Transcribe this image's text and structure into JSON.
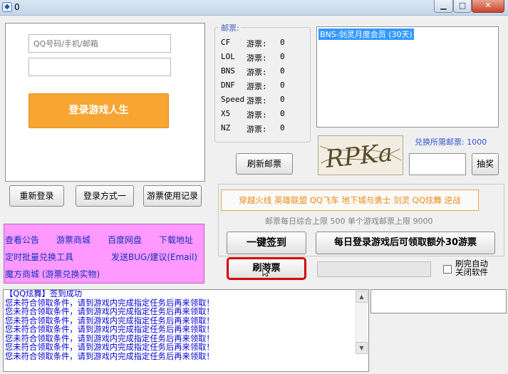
{
  "window": {
    "title": "0",
    "icon": "app-icon",
    "controls": [
      "minimize",
      "maximize",
      "close"
    ]
  },
  "login": {
    "account_placeholder": "QQ号码/手机/邮箱",
    "password_placeholder": "",
    "login_button": "登录游戏人生"
  },
  "actions": {
    "relogin": "重新登录",
    "login_mode": "登录方式一",
    "ticket_log": "游票使用记录"
  },
  "links": {
    "announcement": "查看公告",
    "ticket_store": "游票商城",
    "baidu_pan": "百度网盘",
    "download": "下载地址",
    "batch_exchange": "定时批量兑换工具",
    "send_bug": "发送BUG/建议(Email)",
    "magic_store": "魔方商城 (游票兑换实物)"
  },
  "tickets": {
    "title": "邮票:",
    "column_label": "游票:",
    "rows": [
      {
        "game": "CF",
        "value": "0"
      },
      {
        "game": "LOL",
        "value": "0"
      },
      {
        "game": "BNS",
        "value": "0"
      },
      {
        "game": "DNF",
        "value": "0"
      },
      {
        "game": "Speed",
        "value": "0"
      },
      {
        "game": "X5",
        "value": "0"
      },
      {
        "game": "NZ",
        "value": "0"
      }
    ],
    "refresh_button": "刷新邮票"
  },
  "items": {
    "selected": "BNS-剑灵月度会员 (30天)"
  },
  "exchange": {
    "captcha_text": "RPKa",
    "cost_label": "兑换所需邮票:",
    "cost_value": "1000",
    "lottery_button": "抽奖"
  },
  "games": {
    "tags": "穿越火线 英雄联盟 QQ飞车 地下城与勇士 剑灵 QQ炫舞 逆战",
    "limit_label": "邮票每日综合上限",
    "daily_limit": "500",
    "single_label": "单个游戏邮票上限",
    "single_limit": "9000"
  },
  "controls": {
    "sign_in": "一键签到",
    "daily_extra": "每日登录游戏后可领取额外30游票",
    "refresh_coupon": "刷游票",
    "auto_close_line1": "刷完自动",
    "auto_close_line2": "关闭软件",
    "auto_close_checked": false
  },
  "log": [
    "【QQ炫舞】签到成功",
    "您未符合领取条件，请到游戏内完成指定任务后再来领取！",
    "您未符合领取条件，请到游戏内完成指定任务后再来领取！",
    "您未符合领取条件，请到游戏内完成指定任务后再来领取！",
    "您未符合领取条件，请到游戏内完成指定任务后再来领取！",
    "您未符合领取条件，请到游戏内完成指定任务后再来领取！",
    "您未符合领取条件，请到游戏内完成指定任务后再来领取！",
    "您未符合领取条件，请到游戏内完成指定任务后再来领取！"
  ]
}
